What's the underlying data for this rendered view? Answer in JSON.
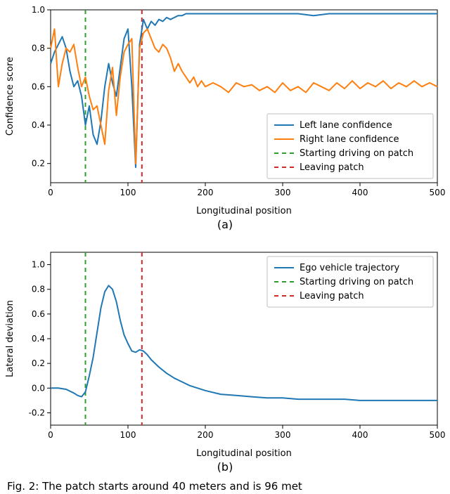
{
  "subcaptions": {
    "a": "(a)",
    "b": "(b)"
  },
  "caption_fragment": "Fig. 2: The patch starts around 40 meters and is 96 met",
  "chart_data": [
    {
      "id": "a",
      "type": "line",
      "xlabel": "Longitudinal position",
      "ylabel": "Confidence score",
      "xlim": [
        0,
        500
      ],
      "ylim": [
        0.1,
        1.0
      ],
      "xticks": [
        0,
        100,
        200,
        300,
        400,
        500
      ],
      "yticks": [
        0.2,
        0.4,
        0.6,
        0.8,
        1.0
      ],
      "vlines": [
        {
          "x": 45,
          "color": "#2ca02c",
          "label": "Starting driving on patch"
        },
        {
          "x": 118,
          "color": "#d62728",
          "label": "Leaving patch"
        }
      ],
      "series": [
        {
          "name": "Left lane confidence",
          "color": "#1f77b4",
          "x": [
            0,
            5,
            10,
            15,
            20,
            25,
            30,
            35,
            40,
            45,
            50,
            55,
            60,
            65,
            70,
            75,
            80,
            85,
            90,
            95,
            100,
            105,
            110,
            115,
            120,
            125,
            130,
            135,
            140,
            145,
            150,
            155,
            160,
            165,
            170,
            175,
            180,
            185,
            190,
            195,
            200,
            210,
            220,
            230,
            240,
            250,
            260,
            270,
            280,
            290,
            300,
            320,
            340,
            360,
            380,
            400,
            420,
            440,
            460,
            480,
            500
          ],
          "y": [
            0.72,
            0.78,
            0.82,
            0.86,
            0.8,
            0.68,
            0.6,
            0.63,
            0.55,
            0.4,
            0.5,
            0.35,
            0.3,
            0.42,
            0.6,
            0.72,
            0.62,
            0.55,
            0.7,
            0.85,
            0.9,
            0.6,
            0.18,
            0.82,
            0.95,
            0.9,
            0.94,
            0.92,
            0.95,
            0.94,
            0.96,
            0.95,
            0.96,
            0.97,
            0.97,
            0.98,
            0.98,
            0.98,
            0.98,
            0.98,
            0.98,
            0.98,
            0.98,
            0.98,
            0.98,
            0.98,
            0.98,
            0.98,
            0.98,
            0.98,
            0.98,
            0.98,
            0.97,
            0.98,
            0.98,
            0.98,
            0.98,
            0.98,
            0.98,
            0.98,
            0.98
          ]
        },
        {
          "name": "Right lane confidence",
          "color": "#ff7f0e",
          "x": [
            0,
            5,
            10,
            15,
            20,
            25,
            30,
            35,
            40,
            45,
            50,
            55,
            60,
            65,
            70,
            75,
            80,
            85,
            90,
            95,
            100,
            105,
            110,
            115,
            120,
            125,
            130,
            135,
            140,
            145,
            150,
            155,
            160,
            165,
            170,
            175,
            180,
            185,
            190,
            195,
            200,
            210,
            220,
            230,
            240,
            250,
            260,
            270,
            280,
            290,
            300,
            310,
            320,
            330,
            340,
            350,
            360,
            370,
            380,
            390,
            400,
            410,
            420,
            430,
            440,
            450,
            460,
            470,
            480,
            490,
            500
          ],
          "y": [
            0.8,
            0.9,
            0.6,
            0.72,
            0.8,
            0.78,
            0.82,
            0.7,
            0.6,
            0.65,
            0.55,
            0.48,
            0.5,
            0.4,
            0.3,
            0.58,
            0.7,
            0.45,
            0.65,
            0.78,
            0.82,
            0.85,
            0.2,
            0.8,
            0.88,
            0.9,
            0.85,
            0.8,
            0.78,
            0.82,
            0.8,
            0.75,
            0.68,
            0.72,
            0.68,
            0.65,
            0.62,
            0.65,
            0.6,
            0.63,
            0.6,
            0.62,
            0.6,
            0.57,
            0.62,
            0.6,
            0.61,
            0.58,
            0.6,
            0.57,
            0.62,
            0.58,
            0.6,
            0.57,
            0.62,
            0.6,
            0.58,
            0.62,
            0.59,
            0.63,
            0.59,
            0.62,
            0.6,
            0.63,
            0.59,
            0.62,
            0.6,
            0.63,
            0.6,
            0.62,
            0.6
          ]
        }
      ],
      "legend": [
        "Left lane confidence",
        "Right lane confidence",
        "Starting driving on patch",
        "Leaving patch"
      ]
    },
    {
      "id": "b",
      "type": "line",
      "xlabel": "Longitudinal position",
      "ylabel": "Lateral deviation",
      "xlim": [
        0,
        500
      ],
      "ylim": [
        -0.3,
        1.1
      ],
      "xticks": [
        0,
        100,
        200,
        300,
        400,
        500
      ],
      "yticks": [
        -0.2,
        0.0,
        0.2,
        0.4,
        0.6,
        0.8,
        1.0
      ],
      "vlines": [
        {
          "x": 45,
          "color": "#2ca02c",
          "label": "Starting driving on patch"
        },
        {
          "x": 118,
          "color": "#d62728",
          "label": "Leaving patch"
        }
      ],
      "series": [
        {
          "name": "Ego vehicle trajectory",
          "color": "#1f77b4",
          "x": [
            0,
            10,
            20,
            30,
            35,
            40,
            45,
            50,
            55,
            60,
            65,
            70,
            75,
            80,
            85,
            90,
            95,
            100,
            105,
            110,
            115,
            120,
            125,
            130,
            140,
            150,
            160,
            170,
            180,
            190,
            200,
            220,
            240,
            260,
            280,
            300,
            320,
            340,
            360,
            380,
            400,
            420,
            440,
            460,
            480,
            500
          ],
          "y": [
            0.0,
            0.0,
            -0.01,
            -0.04,
            -0.06,
            -0.07,
            -0.03,
            0.1,
            0.25,
            0.45,
            0.65,
            0.78,
            0.83,
            0.8,
            0.7,
            0.55,
            0.43,
            0.36,
            0.3,
            0.29,
            0.31,
            0.3,
            0.27,
            0.23,
            0.17,
            0.12,
            0.08,
            0.05,
            0.02,
            0.0,
            -0.02,
            -0.05,
            -0.06,
            -0.07,
            -0.08,
            -0.08,
            -0.09,
            -0.09,
            -0.09,
            -0.09,
            -0.1,
            -0.1,
            -0.1,
            -0.1,
            -0.1,
            -0.1
          ]
        }
      ],
      "legend": [
        "Ego vehicle trajectory",
        "Starting driving on patch",
        "Leaving patch"
      ]
    }
  ]
}
